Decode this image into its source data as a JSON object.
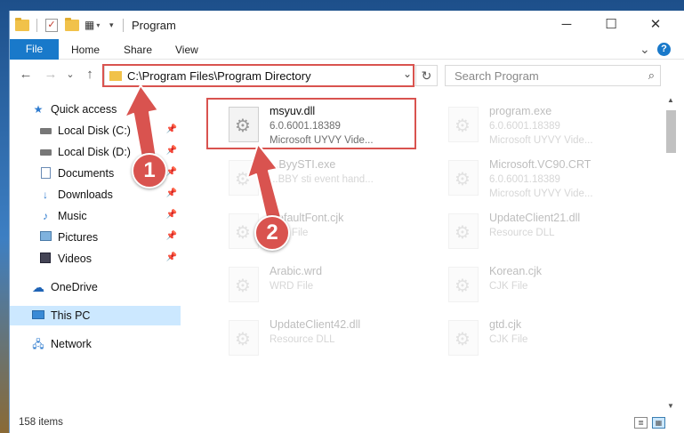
{
  "window": {
    "title": "Program",
    "controls": {
      "minimize": "─",
      "maximize": "☐",
      "close": "✕"
    }
  },
  "ribbon": {
    "tabs": [
      "File",
      "Home",
      "Share",
      "View"
    ],
    "collapse": "⌄",
    "help": "?"
  },
  "nav": {
    "back": "←",
    "forward": "→",
    "recent": "⌄",
    "up": "↑"
  },
  "address": {
    "path": "C:\\Program Files\\Program Directory",
    "dropdown": "⌄",
    "refresh": "↻"
  },
  "search": {
    "placeholder": "Search Program",
    "icon": "⌕"
  },
  "sidebar": {
    "items": [
      {
        "label": "Quick access",
        "icon": "star-icon"
      },
      {
        "label": "Local Disk (C:)",
        "icon": "drive-icon"
      },
      {
        "label": "Local Disk (D:)",
        "icon": "drive-icon"
      },
      {
        "label": "Documents",
        "icon": "documents-icon"
      },
      {
        "label": "Downloads",
        "icon": "download-icon"
      },
      {
        "label": "Music",
        "icon": "music-icon"
      },
      {
        "label": "Pictures",
        "icon": "pictures-icon"
      },
      {
        "label": "Videos",
        "icon": "videos-icon"
      },
      {
        "label": "OneDrive",
        "icon": "cloud-icon"
      },
      {
        "label": "This PC",
        "icon": "computer-icon"
      },
      {
        "label": "Network",
        "icon": "network-icon"
      }
    ]
  },
  "files": [
    {
      "name": "msyuv.dll",
      "l2": "6.0.6001.18389",
      "l3": "Microsoft UYVY Vide..."
    },
    {
      "name": "program.exe",
      "l2": "6.0.6001.18389",
      "l3": "Microsoft UYVY Vide..."
    },
    {
      "name": "...ByySTI.exe",
      "l2": "...BBY sti event hand...",
      "l3": ""
    },
    {
      "name": "Microsoft.VC90.CRT",
      "l2": "6.0.6001.18389",
      "l3": "Microsoft UYVY Vide..."
    },
    {
      "name": "DefaultFont.cjk",
      "l2": "CJK File",
      "l3": ""
    },
    {
      "name": "UpdateClient21.dll",
      "l2": "Resource DLL",
      "l3": ""
    },
    {
      "name": "Arabic.wrd",
      "l2": "WRD File",
      "l3": ""
    },
    {
      "name": "Korean.cjk",
      "l2": "CJK File",
      "l3": ""
    },
    {
      "name": "UpdateClient42.dll",
      "l2": "Resource DLL",
      "l3": ""
    },
    {
      "name": "gtd.cjk",
      "l2": "CJK File",
      "l3": ""
    }
  ],
  "status": {
    "count": "158 items"
  },
  "callouts": [
    "1",
    "2"
  ],
  "colors": {
    "accent": "#1979ca",
    "highlight": "#d9534f",
    "selected": "#cce8ff"
  }
}
